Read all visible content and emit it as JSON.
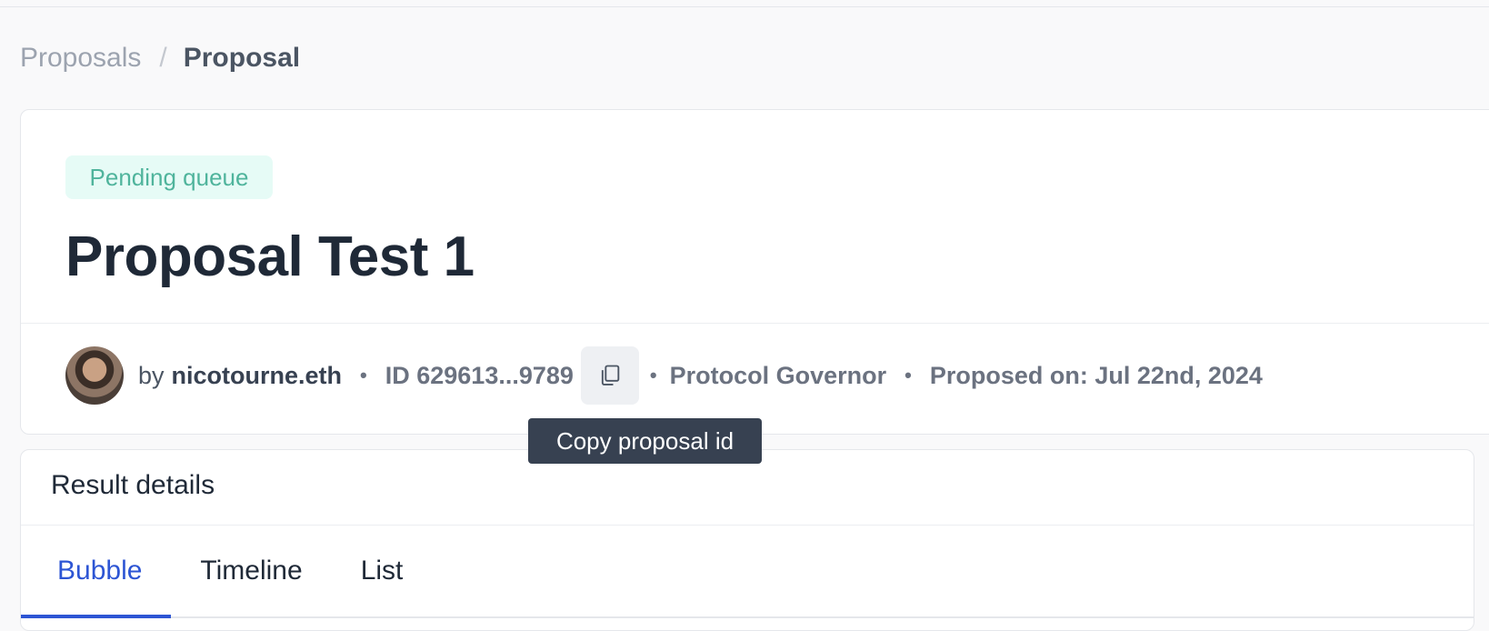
{
  "breadcrumb": {
    "parent": "Proposals",
    "separator": "/",
    "current": "Proposal"
  },
  "proposal": {
    "status": "Pending queue",
    "title": "Proposal Test 1",
    "by_label": "by",
    "author": "nicotourne.eth",
    "id_text": "ID 629613...9789",
    "governor": "Protocol Governor",
    "proposed_on": "Proposed on: Jul 22nd, 2024",
    "separator": "•"
  },
  "tooltip": {
    "text": "Copy proposal id"
  },
  "results": {
    "title": "Result details",
    "tabs": [
      {
        "label": "Bubble",
        "active": true
      },
      {
        "label": "Timeline",
        "active": false
      },
      {
        "label": "List",
        "active": false
      }
    ]
  },
  "colors": {
    "accent": "#2d55d4",
    "status_text": "#4fb49c",
    "status_bg": "#e6fbf6",
    "tooltip_bg": "#374151"
  },
  "icons": {
    "copy": "copy-icon"
  }
}
